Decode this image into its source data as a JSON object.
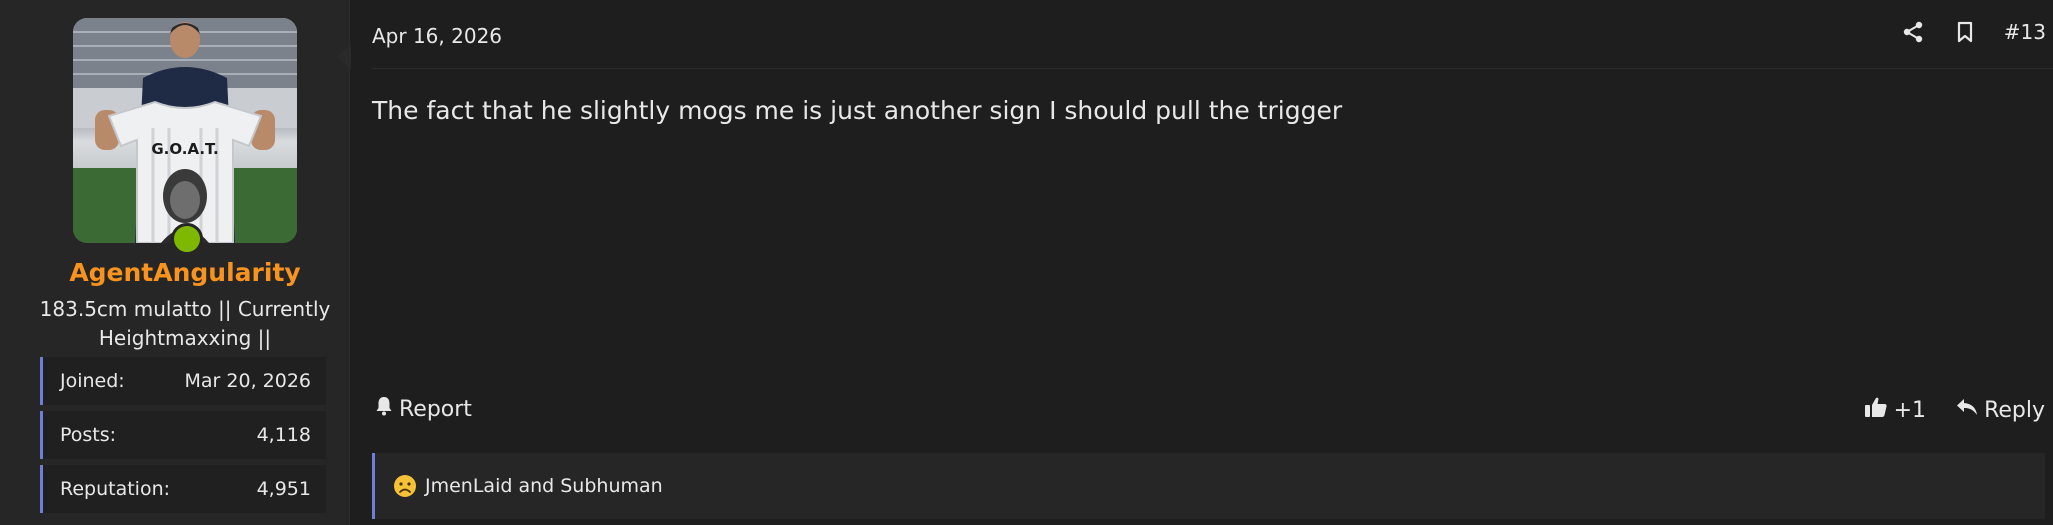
{
  "user": {
    "username": "AgentAngularity",
    "title": "183.5cm mulatto || Currently Heightmaxxing ||",
    "avatar_text": "G.O.A.T.",
    "stats": [
      {
        "label": "Joined:",
        "value": "Mar 20, 2026"
      },
      {
        "label": "Posts:",
        "value": "4,118"
      },
      {
        "label": "Reputation:",
        "value": "4,951"
      }
    ],
    "online_color": "#7fb800",
    "name_color": "#f7931e"
  },
  "post": {
    "date": "Apr 16, 2026",
    "number": "#13",
    "message": "The fact that he slightly mogs me is just another sign I should pull the trigger",
    "report_label": "Report",
    "like_count": "+1",
    "reply_label": "Reply",
    "reactions_text": "JmenLaid and Subhuman"
  },
  "icons": {
    "share": "share-icon",
    "bookmark": "bookmark-icon",
    "bell": "bell-icon",
    "like": "thumbs-up-icon",
    "reply": "reply-icon",
    "reaction": "sad-face-icon"
  },
  "colors": {
    "accent": "#6f7fd6",
    "background": "#1e1e1e",
    "panel": "#262626"
  }
}
